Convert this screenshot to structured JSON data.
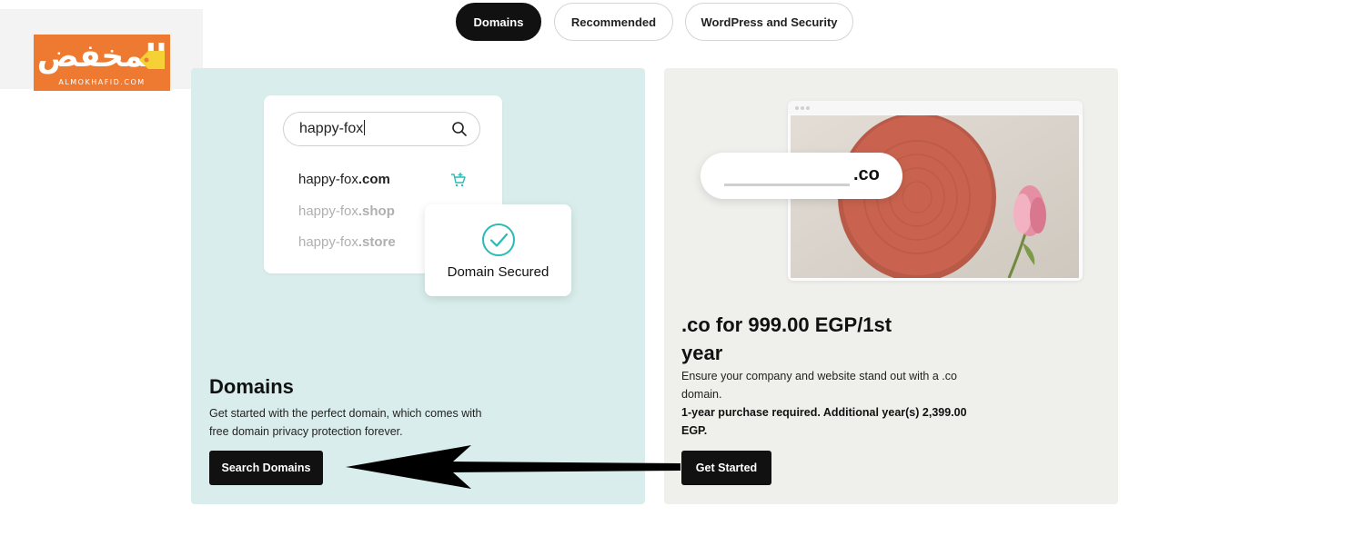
{
  "logo": {
    "arabic_text": "المخفض",
    "latin_text": "ALMOKHAFID.COM",
    "brand_color": "#ee7a31"
  },
  "tabs": [
    {
      "label": "Domains",
      "active": true
    },
    {
      "label": "Recommended",
      "active": false
    },
    {
      "label": "WordPress and Security",
      "active": false
    }
  ],
  "domains_card": {
    "background": "#d9eeec",
    "search": {
      "value": "happy-fox",
      "icon": "search-icon"
    },
    "results": [
      {
        "name": "happy-fox",
        "tld": ".com"
      },
      {
        "name": "happy-fox",
        "tld": ".shop"
      },
      {
        "name": "happy-fox",
        "tld": ".store"
      }
    ],
    "cart_icon": "add-to-cart-icon",
    "secured_label": "Domain Secured",
    "title": "Domains",
    "description": "Get started with the perfect domain, which comes with free domain privacy protection forever.",
    "button_label": "Search Domains"
  },
  "co_card": {
    "background": "#efefec",
    "pill_text": ".co",
    "title": ".co for 999.00 EGP/1st year",
    "description": "Ensure your company and website stand out with a .co domain.",
    "note": "1-year purchase required. Additional year(s) 2,399.00 EGP.",
    "button_label": "Get Started"
  },
  "colors": {
    "button_bg": "#111111",
    "tab_active_bg": "#111111",
    "check_color": "#2bbbb5",
    "plate_color": "#c9634f"
  }
}
